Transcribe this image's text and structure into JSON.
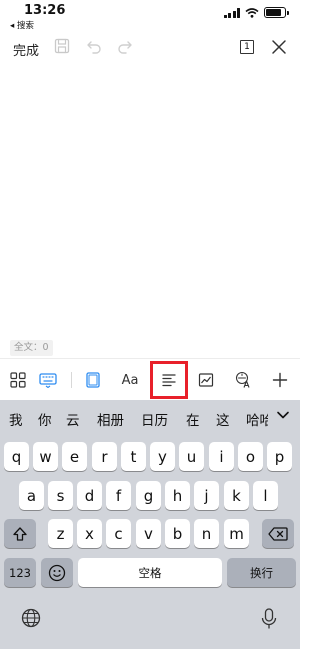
{
  "status_bar": {
    "time": "13:26",
    "back_app": "◂ 搜索",
    "battery_level": 0.85
  },
  "toolbar": {
    "done_label": "完成",
    "page_count": "1"
  },
  "editor": {
    "word_count": "全文：0"
  },
  "format_toolbar": {
    "selected_tool": "paragraph-align"
  },
  "candidates": [
    "我",
    "你",
    "云",
    "相册",
    "日历",
    "在",
    "这",
    "哈哈"
  ],
  "keyboard": {
    "row1": [
      "q",
      "w",
      "e",
      "r",
      "t",
      "y",
      "u",
      "i",
      "o",
      "p"
    ],
    "row2": [
      "a",
      "s",
      "d",
      "f",
      "g",
      "h",
      "j",
      "k",
      "l"
    ],
    "row3": [
      "z",
      "x",
      "c",
      "v",
      "b",
      "n",
      "m"
    ],
    "numbers_label": "123",
    "space_label": "空格",
    "return_label": "换行"
  },
  "colors": {
    "accent_blue": "#2d8cf0",
    "highlight_red": "#e8202a",
    "keyboard_bg": "#d1d4da"
  }
}
